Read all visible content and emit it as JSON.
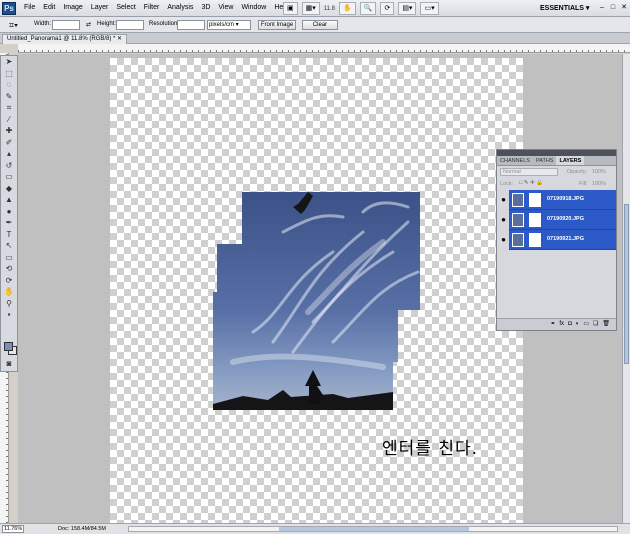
{
  "app": {
    "logo": "Ps"
  },
  "menu": [
    "File",
    "Edit",
    "Image",
    "Layer",
    "Select",
    "Filter",
    "Analysis",
    "3D",
    "View",
    "Window",
    "Help"
  ],
  "menubar": {
    "zoom": "11.8",
    "workspace": "ESSENTIALS"
  },
  "options": {
    "width_label": "Width:",
    "height_label": "Height:",
    "resolution_label": "Resolution:",
    "unit": "pixels/cm",
    "front_image": "Front Image",
    "clear": "Clear"
  },
  "document": {
    "tab_title": "Untitled_Panorama1 @ 11.8% (RGB/8) *"
  },
  "status": {
    "zoom": "11.76%",
    "doc_info": "Doc: 158.4M/84.5M"
  },
  "layers_panel": {
    "tabs": [
      "CHANNELS",
      "PATHS",
      "LAYERS"
    ],
    "active_tab": "LAYERS",
    "blend_mode": "Normal",
    "opacity_label": "Opacity:",
    "opacity": "100%",
    "lock_label": "Lock:",
    "fill_label": "Fill:",
    "fill": "100%",
    "layers": [
      {
        "name": "07190918.JPG"
      },
      {
        "name": "07190920.JPG"
      },
      {
        "name": "07190921.JPG"
      }
    ]
  },
  "caption": "엔터를 친다.",
  "colors": {
    "selection": "#2c5ac8",
    "sky": "#4a5f95",
    "foreground_swatch": "#7b8fb9"
  }
}
